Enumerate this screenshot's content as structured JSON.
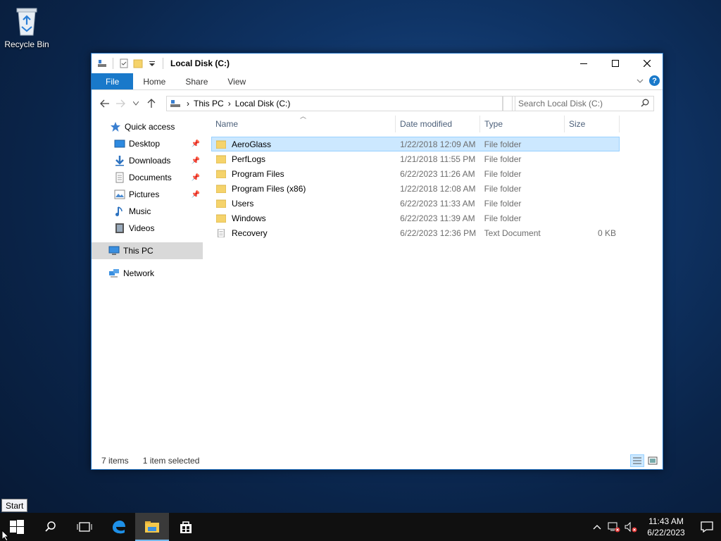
{
  "desktop": {
    "recycle_bin_label": "Recycle Bin"
  },
  "window": {
    "title": "Local Disk (C:)",
    "ribbon_tabs": [
      "File",
      "Home",
      "Share",
      "View"
    ],
    "breadcrumb": [
      "This PC",
      "Local Disk (C:)"
    ],
    "search_placeholder": "Search Local Disk (C:)",
    "nav": {
      "quick_access": "Quick access",
      "items": [
        {
          "label": "Desktop",
          "pinned": true
        },
        {
          "label": "Downloads",
          "pinned": true
        },
        {
          "label": "Documents",
          "pinned": true
        },
        {
          "label": "Pictures",
          "pinned": true
        },
        {
          "label": "Music",
          "pinned": false
        },
        {
          "label": "Videos",
          "pinned": false
        }
      ],
      "this_pc": "This PC",
      "network": "Network"
    },
    "columns": {
      "name": "Name",
      "date": "Date modified",
      "type": "Type",
      "size": "Size"
    },
    "rows": [
      {
        "name": "AeroGlass",
        "date": "1/22/2018 12:09 AM",
        "type": "File folder",
        "size": "",
        "selected": true
      },
      {
        "name": "PerfLogs",
        "date": "1/21/2018 11:55 PM",
        "type": "File folder",
        "size": ""
      },
      {
        "name": "Program Files",
        "date": "6/22/2023 11:26 AM",
        "type": "File folder",
        "size": ""
      },
      {
        "name": "Program Files (x86)",
        "date": "1/22/2018 12:08 AM",
        "type": "File folder",
        "size": ""
      },
      {
        "name": "Users",
        "date": "6/22/2023 11:33 AM",
        "type": "File folder",
        "size": ""
      },
      {
        "name": "Windows",
        "date": "6/22/2023 11:39 AM",
        "type": "File folder",
        "size": ""
      },
      {
        "name": "Recovery",
        "date": "6/22/2023 12:36 PM",
        "type": "Text Document",
        "size": "0 KB"
      }
    ],
    "status": {
      "items": "7 items",
      "selected": "1 item selected"
    }
  },
  "tooltip": "Start",
  "taskbar": {
    "time": "11:43 AM",
    "date": "6/22/2023"
  },
  "colors": {
    "accent": "#1979ca",
    "selection": "#cce8ff",
    "folder": "#f5d36b"
  }
}
